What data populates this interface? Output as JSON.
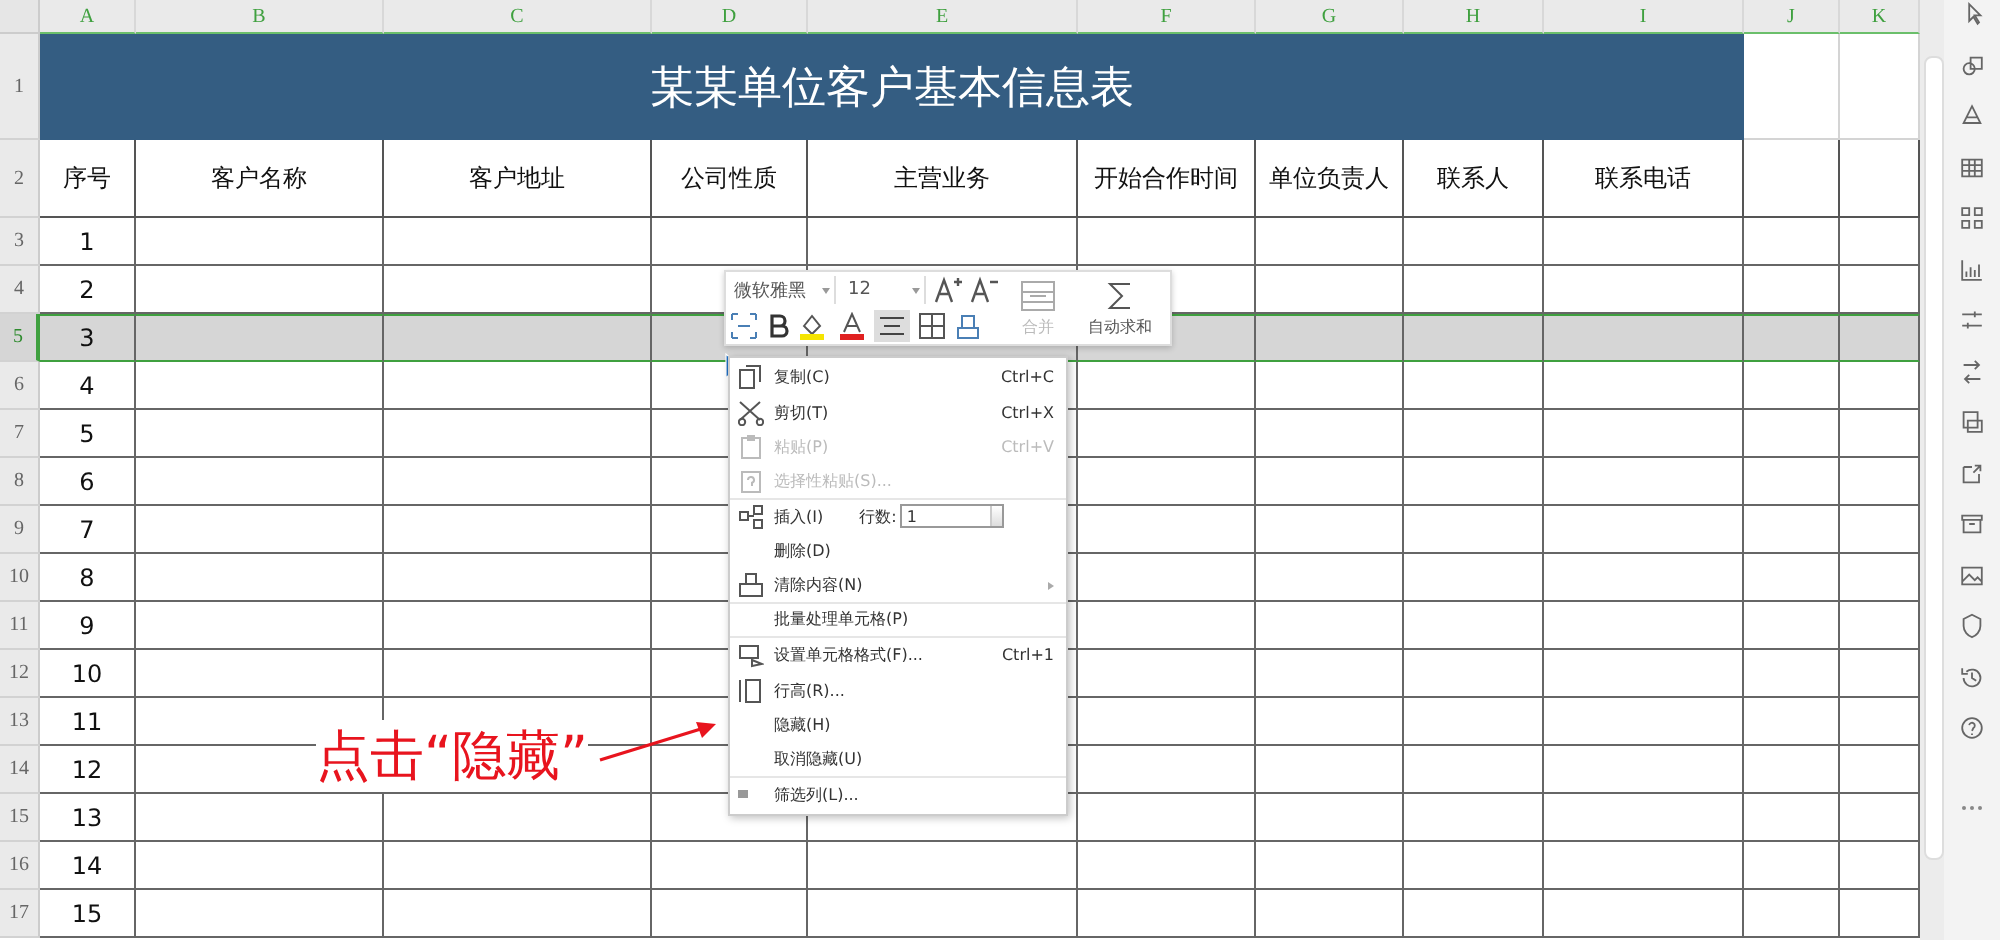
{
  "column_headers": [
    "A",
    "B",
    "C",
    "D",
    "E",
    "F",
    "G",
    "H",
    "I",
    "J",
    "K"
  ],
  "title_row_label": "1",
  "title": "某某单位客户基本信息表",
  "header_row_label": "2",
  "headers": [
    "序号",
    "客户名称",
    "客户地址",
    "公司性质",
    "主营业务",
    "开始合作时间",
    "单位负责人",
    "联系人",
    "联系电话"
  ],
  "rows": [
    {
      "row_label": "3",
      "number": "1",
      "selected": false
    },
    {
      "row_label": "4",
      "number": "2",
      "selected": false
    },
    {
      "row_label": "5",
      "number": "3",
      "selected": true
    },
    {
      "row_label": "6",
      "number": "4",
      "selected": false
    },
    {
      "row_label": "7",
      "number": "5",
      "selected": false
    },
    {
      "row_label": "8",
      "number": "6",
      "selected": false
    },
    {
      "row_label": "9",
      "number": "7",
      "selected": false
    },
    {
      "row_label": "10",
      "number": "8",
      "selected": false
    },
    {
      "row_label": "11",
      "number": "9",
      "selected": false
    },
    {
      "row_label": "12",
      "number": "10",
      "selected": false
    },
    {
      "row_label": "13",
      "number": "11",
      "selected": false
    },
    {
      "row_label": "14",
      "number": "12",
      "selected": false
    },
    {
      "row_label": "15",
      "number": "13",
      "selected": false
    },
    {
      "row_label": "16",
      "number": "14",
      "selected": false
    },
    {
      "row_label": "17",
      "number": "15",
      "selected": false
    }
  ],
  "mini_toolbar": {
    "font": "微软雅黑",
    "size": "12",
    "merge": "合并",
    "autosum": "自动求和"
  },
  "context_menu": [
    {
      "kind": "copy",
      "label": "复制(C)",
      "shortcut": "Ctrl+C",
      "disabled": false,
      "separator_after": false
    },
    {
      "kind": "cut",
      "label": "剪切(T)",
      "shortcut": "Ctrl+X",
      "disabled": false,
      "separator_after": false
    },
    {
      "kind": "paste",
      "label": "粘贴(P)",
      "shortcut": "Ctrl+V",
      "disabled": true,
      "separator_after": false
    },
    {
      "kind": "paste-special",
      "label": "选择性粘贴(S)...",
      "disabled": true,
      "separator_after": true
    },
    {
      "kind": "insert",
      "label": "插入(I)",
      "count_label": "行数:",
      "count": "1",
      "disabled": false,
      "separator_after": false
    },
    {
      "kind": "plain",
      "label": "删除(D)",
      "disabled": false,
      "separator_after": false
    },
    {
      "kind": "clear",
      "label": "清除内容(N)",
      "submenu": true,
      "disabled": false,
      "separator_after": true
    },
    {
      "kind": "plain",
      "label": "批量处理单元格(P)",
      "disabled": false,
      "separator_after": true
    },
    {
      "kind": "format",
      "label": "设置单元格格式(F)...",
      "shortcut": "Ctrl+1",
      "disabled": false,
      "separator_after": false
    },
    {
      "kind": "row-height",
      "label": "行高(R)...",
      "disabled": false,
      "separator_after": false
    },
    {
      "kind": "plain",
      "label": "隐藏(H)",
      "disabled": false,
      "separator_after": false
    },
    {
      "kind": "plain",
      "label": "取消隐藏(U)",
      "disabled": false,
      "separator_after": true
    },
    {
      "kind": "filter",
      "label": "筛选列(L)...",
      "disabled": false,
      "separator_after": false
    }
  ],
  "annotation": "点击“隐藏”"
}
